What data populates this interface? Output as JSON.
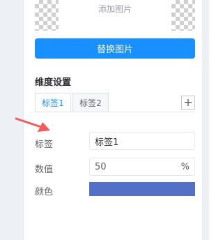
{
  "image_panel": {
    "add_image_label": "添加图片",
    "replace_button": "替换图片"
  },
  "dimension": {
    "title": "维度设置",
    "tabs": [
      {
        "label": "标签1",
        "active": true
      },
      {
        "label": "标签2",
        "active": false
      }
    ],
    "add_tab_icon": "plus-icon"
  },
  "form": {
    "name_label": "标签",
    "name_value": "标签1",
    "value_label": "数值",
    "value": "50",
    "value_unit": "%",
    "color_label": "颜色",
    "color_value": "#5470c6"
  },
  "colors": {
    "primary": "#1890ff",
    "arrow": "#f25b5b"
  }
}
